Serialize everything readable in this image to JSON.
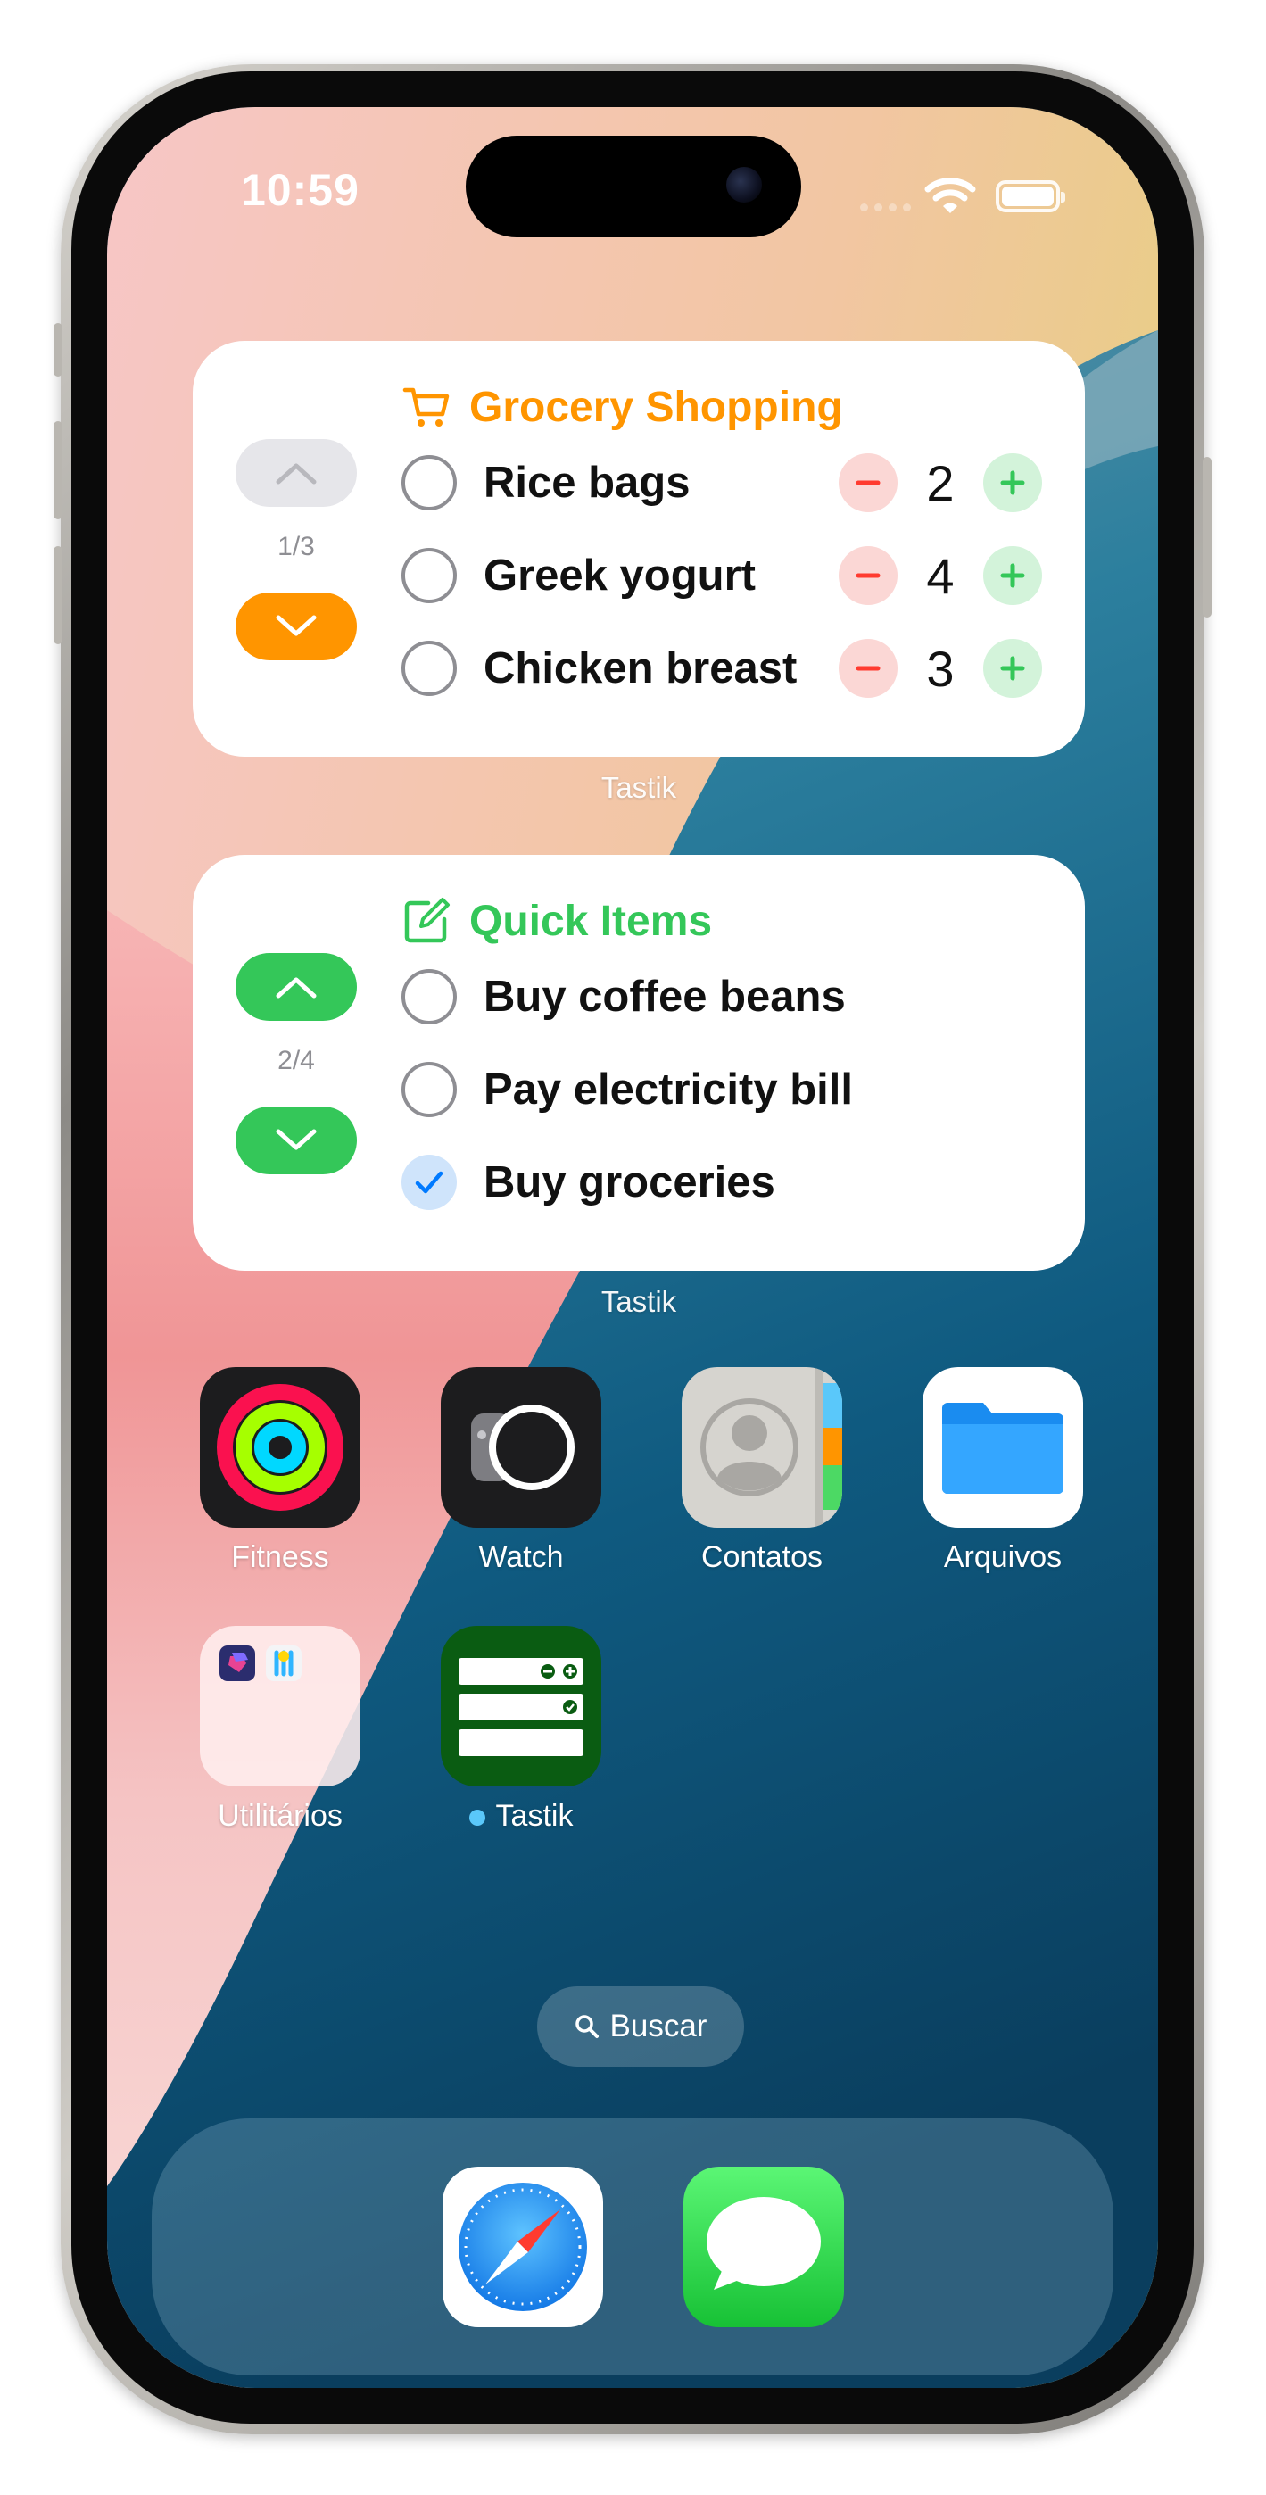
{
  "status_bar": {
    "time": "10:59"
  },
  "widgets": [
    {
      "title": "Grocery Shopping",
      "accent": "#ff9500",
      "page_indicator": "1/3",
      "app_label": "Tastik",
      "items": [
        {
          "name": "Rice bags",
          "qty": "2",
          "done": false
        },
        {
          "name": "Greek yogurt",
          "qty": "4",
          "done": false
        },
        {
          "name": "Chicken breast",
          "qty": "3",
          "done": false
        }
      ]
    },
    {
      "title": "Quick Items",
      "accent": "#34c759",
      "page_indicator": "2/4",
      "app_label": "Tastik",
      "items": [
        {
          "name": "Buy coffee beans",
          "done": false
        },
        {
          "name": "Pay electricity bill",
          "done": false
        },
        {
          "name": "Buy groceries",
          "done": true
        }
      ]
    }
  ],
  "apps": [
    {
      "label": "Fitness",
      "icon": "fitness-icon"
    },
    {
      "label": "Watch",
      "icon": "watch-icon"
    },
    {
      "label": "Contatos",
      "icon": "contacts-icon"
    },
    {
      "label": "Arquivos",
      "icon": "files-icon"
    },
    {
      "label": "Utilitários",
      "icon": "utilities-folder-icon"
    },
    {
      "label": "Tastik",
      "icon": "tastik-icon",
      "new_badge": true
    }
  ],
  "search": {
    "label": "Buscar"
  },
  "dock": [
    {
      "icon": "safari-icon"
    },
    {
      "icon": "messages-icon"
    }
  ],
  "colors": {
    "orange": "#ff9500",
    "green": "#34c759",
    "red": "#ff3b30",
    "blue": "#007aff"
  }
}
